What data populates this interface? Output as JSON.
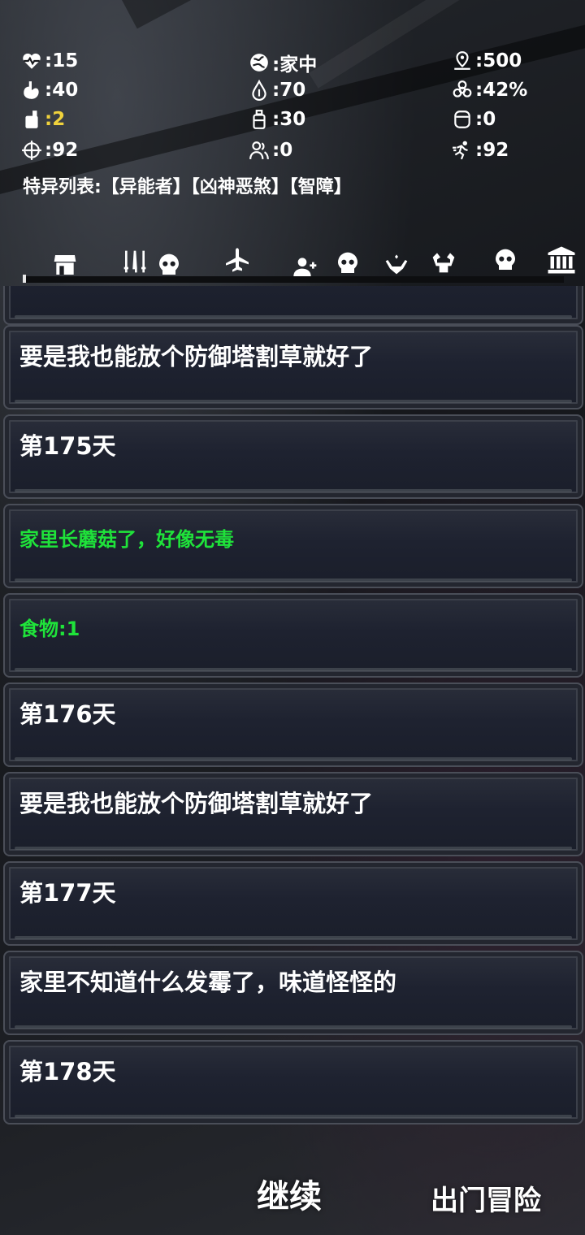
{
  "stats": [
    {
      "id": "health",
      "icon": "heartbeat-icon",
      "value": ":15"
    },
    {
      "id": "location",
      "icon": "globe-icon",
      "value": ":家中"
    },
    {
      "id": "distance",
      "icon": "map-pin-icon",
      "value": ":500"
    },
    {
      "id": "hunger",
      "icon": "stomach-icon",
      "value": ":40"
    },
    {
      "id": "water",
      "icon": "water-drop-icon",
      "value": ":70"
    },
    {
      "id": "infection",
      "icon": "biohazard-icon",
      "value": ":42%"
    },
    {
      "id": "food",
      "icon": "food-can-icon",
      "value": ":2",
      "color": "#f0d23c"
    },
    {
      "id": "bottle",
      "icon": "bottle-icon",
      "value": ":30"
    },
    {
      "id": "barrel",
      "icon": "barrel-icon",
      "value": ":0"
    },
    {
      "id": "accuracy",
      "icon": "crosshair-icon",
      "value": ":92"
    },
    {
      "id": "survivors",
      "icon": "people-icon",
      "value": ":0"
    },
    {
      "id": "agility",
      "icon": "running-icon",
      "value": ":92"
    }
  ],
  "traits_text": "特异列表:【异能者】【凶神恶煞】【智障】",
  "toolbar": [
    "shop-icon",
    "weapons-icon",
    "skull-icon",
    "airplane-icon",
    "add-user-icon",
    "skull-icon",
    "healing-hands-icon",
    "muscle-icon",
    "skull-icon",
    "museum-icon"
  ],
  "log": [
    {
      "text": "",
      "color": "white"
    },
    {
      "text": "要是我也能放个防御塔割草就好了",
      "color": "white"
    },
    {
      "text": "第175天",
      "color": "white"
    },
    {
      "text": "家里长蘑菇了，好像无毒",
      "color": "green"
    },
    {
      "text": " 食物:1",
      "color": "green"
    },
    {
      "text": "第176天",
      "color": "white"
    },
    {
      "text": "要是我也能放个防御塔割草就好了",
      "color": "white"
    },
    {
      "text": "第177天",
      "color": "white"
    },
    {
      "text": "家里不知道什么发霉了，味道怪怪的",
      "color": "white"
    },
    {
      "text": "第178天",
      "color": "white"
    }
  ],
  "buttons": {
    "continue": "继续",
    "adventure": "出门冒险"
  },
  "colors": {
    "green": "#1fe33a",
    "yellow": "#f0d23c"
  }
}
